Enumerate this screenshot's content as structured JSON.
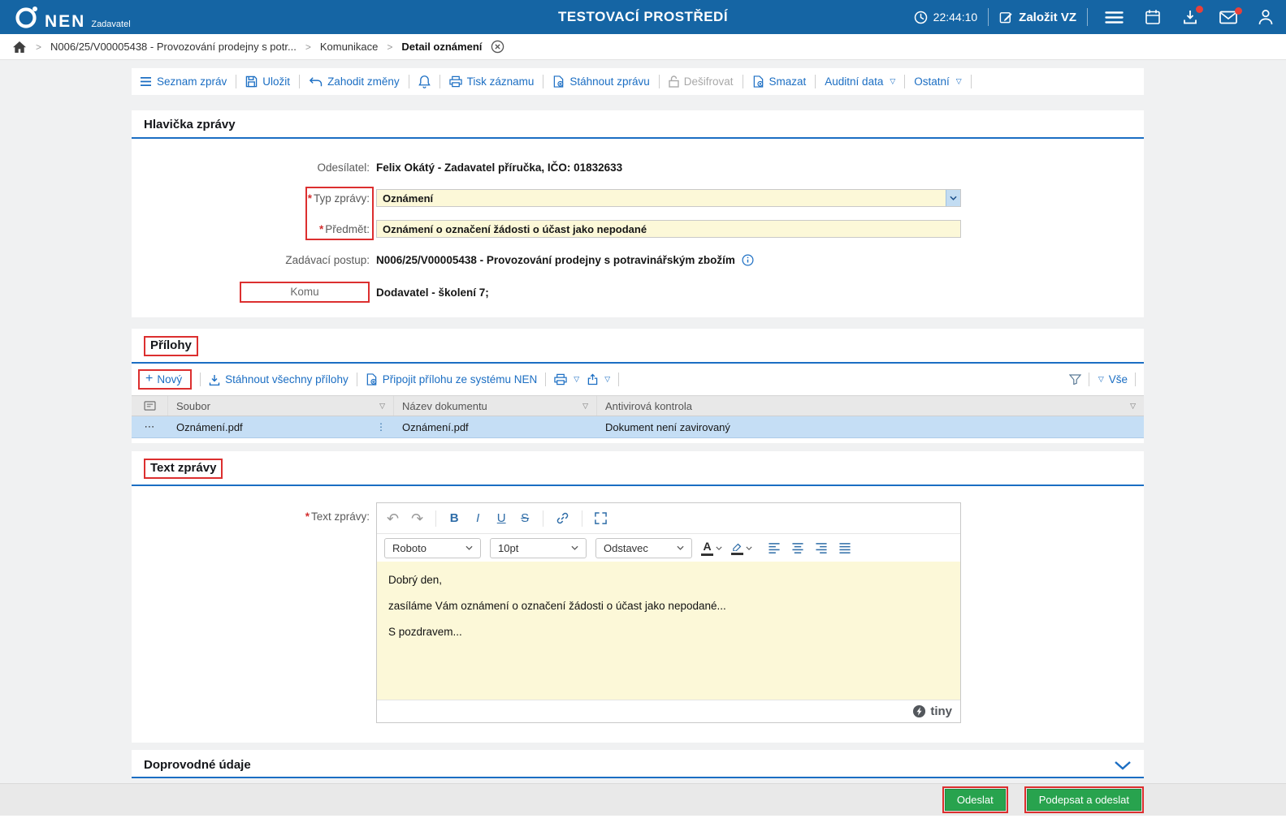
{
  "colors": {
    "header_bg": "#1565A4",
    "link_blue": "#1B6EC3",
    "annotation_red": "#DC2F2F",
    "button_green": "#28A34E",
    "input_yellow": "#FCF8D8",
    "selected_row": "#C5DEF5"
  },
  "required_marker": "*",
  "icons": {
    "caret": "▽",
    "plus": "+",
    "undo": "↶",
    "redo": "↷",
    "bold": "B",
    "italic": "I",
    "underline": "U",
    "strike": "S",
    "font_color_letter": "A",
    "row_menu": "⋯",
    "drag_handle": "⋮",
    "crumb_sep": ">"
  },
  "top_header": {
    "brand": "NEN",
    "brand_sub": "Zadavatel",
    "env_title": "TESTOVACÍ PROSTŘEDÍ",
    "time": "22:44:10",
    "create_button": "Založit VZ"
  },
  "breadcrumb": {
    "items": [
      "N006/25/V00005438 - Provozování prodejny s potr...",
      "Komunikace",
      "Detail oznámení"
    ]
  },
  "toolbar": {
    "list_messages": "Seznam zpráv",
    "save": "Uložit",
    "discard_changes": "Zahodit změny",
    "print_record": "Tisk záznamu",
    "download_message": "Stáhnout zprávu",
    "decrypt": "Dešifrovat",
    "delete": "Smazat",
    "audit_data": "Auditní data",
    "other": "Ostatní"
  },
  "header_section": {
    "title": "Hlavička zprávy",
    "sender_label": "Odesílatel:",
    "sender_value": "Felix Okátý - Zadavatel příručka, IČO: 01832633",
    "type_label": "Typ zprávy:",
    "type_value": "Oznámení",
    "subject_label": "Předmět:",
    "subject_value": "Oznámení o označení žádosti o účast jako nepodané",
    "procedure_label": "Zadávací postup:",
    "procedure_value": "N006/25/V00005438 - Provozování prodejny s potravinářským zbožím",
    "to_label": "Komu",
    "to_value": "Dodavatel - školení 7;"
  },
  "attachments": {
    "title": "Přílohy",
    "new_button": "Nový",
    "download_all": "Stáhnout všechny přílohy",
    "attach_from_nen": "Připojit přílohu ze systému NEN",
    "filter_all": "Vše",
    "columns": {
      "file": "Soubor",
      "doc_name": "Název dokumentu",
      "antivirus": "Antivirová kontrola"
    },
    "row": {
      "file": "Oznámení.pdf",
      "doc_name": "Oznámení.pdf",
      "antivirus": "Dokument není zavirovaný"
    }
  },
  "text_section": {
    "title": "Text zprávy",
    "label": "Text zprávy:",
    "font_name": "Roboto",
    "font_size": "10pt",
    "block_format": "Odstavec",
    "line1": "Dobrý den,",
    "line2": "zasíláme Vám oznámení o označení žádosti o účast jako nepodané...",
    "line3": "S pozdravem...",
    "editor_brand": "tiny"
  },
  "extra_section": {
    "title": "Doprovodné údaje"
  },
  "footer": {
    "send": "Odeslat",
    "sign_and_send": "Podepsat a odeslat"
  }
}
